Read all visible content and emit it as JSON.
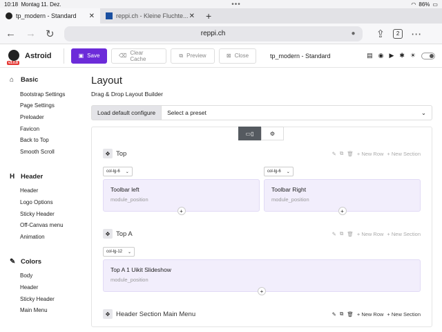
{
  "status": {
    "time": "10:18",
    "date": "Montag 11. Dez.",
    "battery": "86%"
  },
  "tabs": [
    {
      "label": "tp_modern - Standard"
    },
    {
      "label": "reppi.ch - Kleine Fluchte..."
    }
  ],
  "url": {
    "value": "reppi.ch",
    "tab_count": "2"
  },
  "header": {
    "app_name": "Astroid",
    "version": "v3.0.8",
    "save_label": "Save",
    "clear_cache_label": "Clear Cache",
    "preview_label": "Preview",
    "close_label": "Close",
    "page_title": "tp_modern - Standard"
  },
  "sidebar": {
    "groups": [
      {
        "title": "Basic",
        "items": [
          "Bootstrap Settings",
          "Page Settings",
          "Preloader",
          "Favicon",
          "Back to Top",
          "Smooth Scroll"
        ]
      },
      {
        "title": "Header",
        "items": [
          "Header",
          "Logo Options",
          "Sticky Header",
          "Off-Canvas menu",
          "Animation"
        ]
      },
      {
        "title": "Colors",
        "items": [
          "Body",
          "Header",
          "Sticky Header",
          "Main Menu"
        ]
      }
    ]
  },
  "layout": {
    "title": "Layout",
    "subtitle": "Drag & Drop Layout Builder",
    "load_default_label": "Load default configure",
    "preset_placeholder": "Select a preset",
    "new_row_label": "+ New Row",
    "new_section_label": "+ New Section",
    "sections": [
      {
        "name": "Top",
        "columns": [
          {
            "size": "col-lg-6",
            "title": "Toolbar left",
            "sub": "module_position"
          },
          {
            "size": "col-lg-6",
            "title": "Toolbar Right",
            "sub": "module_position"
          }
        ]
      },
      {
        "name": "Top A",
        "columns": [
          {
            "size": "col-lg-12",
            "title": "Top A 1 Uikit Slideshow",
            "sub": "module_position"
          }
        ]
      },
      {
        "name": "Header Section Main Menu",
        "columns": []
      }
    ]
  }
}
